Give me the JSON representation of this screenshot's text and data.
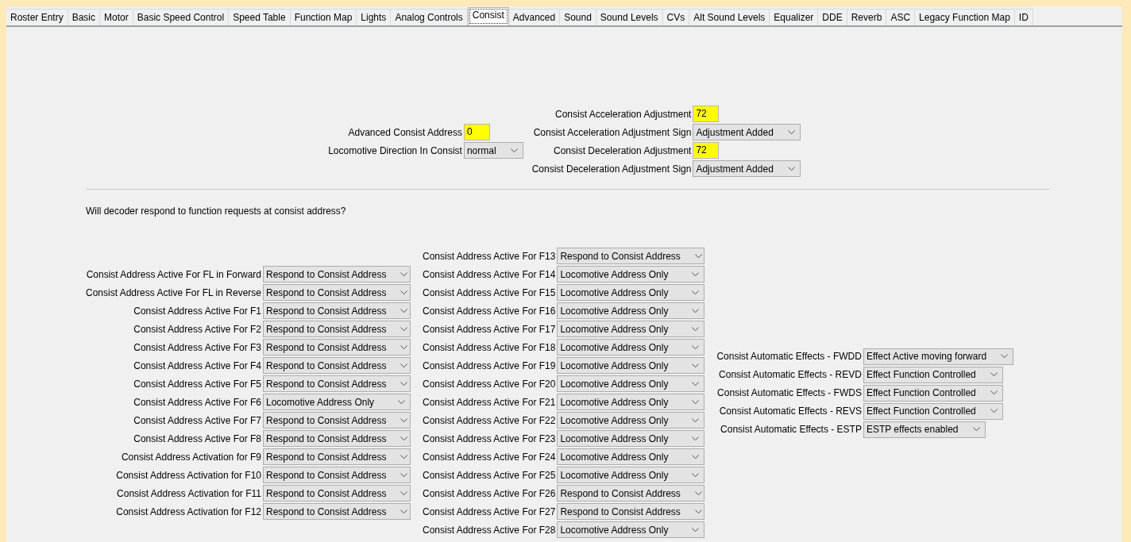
{
  "tabs": [
    {
      "label": "Roster Entry",
      "selected": false
    },
    {
      "label": "Basic",
      "selected": false
    },
    {
      "label": "Motor",
      "selected": false
    },
    {
      "label": "Basic Speed Control",
      "selected": false
    },
    {
      "label": "Speed Table",
      "selected": false
    },
    {
      "label": "Function Map",
      "selected": false
    },
    {
      "label": "Lights",
      "selected": false
    },
    {
      "label": "Analog Controls",
      "selected": false
    },
    {
      "label": "Consist",
      "selected": true
    },
    {
      "label": "Advanced",
      "selected": false
    },
    {
      "label": "Sound",
      "selected": false
    },
    {
      "label": "Sound Levels",
      "selected": false
    },
    {
      "label": "CVs",
      "selected": false
    },
    {
      "label": "Alt Sound Levels",
      "selected": false
    },
    {
      "label": "Equalizer",
      "selected": false
    },
    {
      "label": "DDE",
      "selected": false
    },
    {
      "label": "Reverb",
      "selected": false
    },
    {
      "label": "ASC",
      "selected": false
    },
    {
      "label": "Legacy Function Map",
      "selected": false
    },
    {
      "label": "ID",
      "selected": false
    }
  ],
  "top_groups": [
    {
      "rows": [
        {
          "kind": "text",
          "label": "Advanced Consist Address",
          "value": "0"
        },
        {
          "kind": "select",
          "label": "Locomotive Direction In Consist",
          "value": "normal"
        }
      ]
    },
    {
      "rows": [
        {
          "kind": "text",
          "label": "Consist Acceleration Adjustment",
          "value": "72"
        },
        {
          "kind": "select",
          "label": "Consist Acceleration Adjustment Sign",
          "value": "Adjustment Added"
        },
        {
          "kind": "text",
          "label": "Consist Deceleration Adjustment",
          "value": "72"
        },
        {
          "kind": "select",
          "label": "Consist Deceleration Adjustment Sign",
          "value": "Adjustment Added"
        }
      ]
    }
  ],
  "prompt": "Will decoder respond to function requests at consist address?",
  "function_columns": [
    {
      "rows": [
        {
          "kind": "select",
          "label": "Consist Address Active For FL in Forward",
          "value": "Respond to Consist Address"
        },
        {
          "kind": "select",
          "label": "Consist Address Active For FL in Reverse",
          "value": "Respond to Consist Address"
        },
        {
          "kind": "select",
          "label": "Consist Address Active For F1",
          "value": "Respond to Consist Address"
        },
        {
          "kind": "select",
          "label": "Consist Address Active For F2",
          "value": "Respond to Consist Address"
        },
        {
          "kind": "select",
          "label": "Consist Address Active For F3",
          "value": "Respond to Consist Address"
        },
        {
          "kind": "select",
          "label": "Consist Address Active For F4",
          "value": "Respond to Consist Address"
        },
        {
          "kind": "select",
          "label": "Consist Address Active For F5",
          "value": "Respond to Consist Address"
        },
        {
          "kind": "select",
          "label": "Consist Address Active For F6",
          "value": "Locomotive Address Only"
        },
        {
          "kind": "select",
          "label": "Consist Address Active For F7",
          "value": "Respond to Consist Address"
        },
        {
          "kind": "select",
          "label": "Consist Address Active For F8",
          "value": "Respond to Consist Address"
        },
        {
          "kind": "select",
          "label": "Consist Address Activation for F9",
          "value": "Respond to Consist Address"
        },
        {
          "kind": "select",
          "label": "Consist Address Activation for F10",
          "value": "Respond to Consist Address"
        },
        {
          "kind": "select",
          "label": "Consist Address Activation for F11",
          "value": "Respond to Consist Address"
        },
        {
          "kind": "select",
          "label": "Consist Address Activation for F12",
          "value": "Respond to Consist Address"
        }
      ]
    },
    {
      "rows": [
        {
          "kind": "select",
          "label": "Consist Address Active For F13",
          "value": "Respond to Consist Address"
        },
        {
          "kind": "select",
          "label": "Consist Address Active For F14",
          "value": "Locomotive Address Only"
        },
        {
          "kind": "select",
          "label": "Consist Address Active For F15",
          "value": "Locomotive Address Only"
        },
        {
          "kind": "select",
          "label": "Consist Address Active For F16",
          "value": "Locomotive Address Only"
        },
        {
          "kind": "select",
          "label": "Consist Address Active For F17",
          "value": "Locomotive Address Only"
        },
        {
          "kind": "select",
          "label": "Consist Address Active For F18",
          "value": "Locomotive Address Only"
        },
        {
          "kind": "select",
          "label": "Consist Address Active For F19",
          "value": "Locomotive Address Only"
        },
        {
          "kind": "select",
          "label": "Consist Address Active For F20",
          "value": "Locomotive Address Only"
        },
        {
          "kind": "select",
          "label": "Consist Address Active For F21",
          "value": "Locomotive Address Only"
        },
        {
          "kind": "select",
          "label": "Consist Address Active For F22",
          "value": "Locomotive Address Only"
        },
        {
          "kind": "select",
          "label": "Consist Address Active For F23",
          "value": "Locomotive Address Only"
        },
        {
          "kind": "select",
          "label": "Consist Address Active For F24",
          "value": "Locomotive Address Only"
        },
        {
          "kind": "select",
          "label": "Consist Address Active For F25",
          "value": "Locomotive Address Only"
        },
        {
          "kind": "select",
          "label": "Consist Address Active For F26",
          "value": "Respond to Consist Address"
        },
        {
          "kind": "select",
          "label": "Consist Address Active For F27",
          "value": "Respond to Consist Address"
        },
        {
          "kind": "select",
          "label": "Consist Address Active For F28",
          "value": "Locomotive Address Only"
        }
      ]
    },
    {
      "rows": [
        {
          "kind": "select",
          "label": "Consist Automatic Effects - FWDD",
          "value": "Effect Active moving forward"
        },
        {
          "kind": "select",
          "label": "Consist Automatic Effects - REVD",
          "value": "Effect Function Controlled"
        },
        {
          "kind": "select",
          "label": "Consist Automatic Effects - FWDS",
          "value": "Effect Function Controlled"
        },
        {
          "kind": "select",
          "label": "Consist Automatic Effects - REVS",
          "value": "Effect Function Controlled"
        },
        {
          "kind": "select",
          "label": "Consist Automatic Effects - ESTP",
          "value": "ESTP effects enabled"
        }
      ]
    }
  ]
}
